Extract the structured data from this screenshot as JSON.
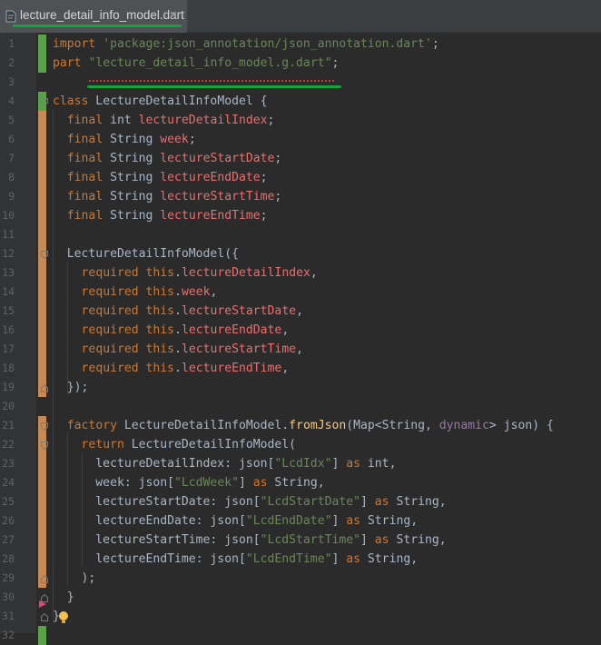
{
  "tab": {
    "filename": "lecture_detail_info_model.dart",
    "close_glyph": "×"
  },
  "lines": [
    {
      "n": "1",
      "change": "green",
      "tokens": [
        [
          "kw",
          "import"
        ],
        [
          "t",
          " "
        ],
        [
          "str",
          "'package:json_annotation/json_annotation.dart'"
        ],
        [
          "t",
          ";"
        ]
      ]
    },
    {
      "n": "2",
      "change": "green",
      "tokens": [
        [
          "kw",
          "part"
        ],
        [
          "t",
          " "
        ],
        [
          "str",
          "\"lecture_detail_info_model.g.dart\""
        ],
        [
          "t",
          ";"
        ]
      ]
    },
    {
      "n": "3",
      "change": "none",
      "tokens": []
    },
    {
      "n": "4",
      "change": "green",
      "tokens": [
        [
          "kw",
          "class"
        ],
        [
          "t",
          " LectureDetailInfoModel {"
        ]
      ]
    },
    {
      "n": "5",
      "change": "orange",
      "tokens": [
        [
          "t",
          "  "
        ],
        [
          "kw",
          "final"
        ],
        [
          "t",
          " int "
        ],
        [
          "fld",
          "lectureDetailIndex"
        ],
        [
          "t",
          ";"
        ]
      ]
    },
    {
      "n": "6",
      "change": "orange",
      "tokens": [
        [
          "t",
          "  "
        ],
        [
          "kw",
          "final"
        ],
        [
          "t",
          " String "
        ],
        [
          "fld",
          "week"
        ],
        [
          "t",
          ";"
        ]
      ]
    },
    {
      "n": "7",
      "change": "orange",
      "tokens": [
        [
          "t",
          "  "
        ],
        [
          "kw",
          "final"
        ],
        [
          "t",
          " String "
        ],
        [
          "fld",
          "lectureStartDate"
        ],
        [
          "t",
          ";"
        ]
      ]
    },
    {
      "n": "8",
      "change": "orange",
      "tokens": [
        [
          "t",
          "  "
        ],
        [
          "kw",
          "final"
        ],
        [
          "t",
          " String "
        ],
        [
          "fld",
          "lectureEndDate"
        ],
        [
          "t",
          ";"
        ]
      ]
    },
    {
      "n": "9",
      "change": "orange",
      "tokens": [
        [
          "t",
          "  "
        ],
        [
          "kw",
          "final"
        ],
        [
          "t",
          " String "
        ],
        [
          "fld",
          "lectureStartTime"
        ],
        [
          "t",
          ";"
        ]
      ]
    },
    {
      "n": "10",
      "change": "orange",
      "tokens": [
        [
          "t",
          "  "
        ],
        [
          "kw",
          "final"
        ],
        [
          "t",
          " String "
        ],
        [
          "fld",
          "lectureEndTime"
        ],
        [
          "t",
          ";"
        ]
      ]
    },
    {
      "n": "11",
      "change": "orange",
      "tokens": []
    },
    {
      "n": "12",
      "change": "orange",
      "tokens": [
        [
          "t",
          "  LectureDetailInfoModel({"
        ]
      ]
    },
    {
      "n": "13",
      "change": "orange",
      "tokens": [
        [
          "t",
          "    "
        ],
        [
          "kw",
          "required"
        ],
        [
          "t",
          " "
        ],
        [
          "kw",
          "this"
        ],
        [
          "t",
          "."
        ],
        [
          "fld",
          "lectureDetailIndex"
        ],
        [
          "t",
          ","
        ]
      ]
    },
    {
      "n": "14",
      "change": "orange",
      "tokens": [
        [
          "t",
          "    "
        ],
        [
          "kw",
          "required"
        ],
        [
          "t",
          " "
        ],
        [
          "kw",
          "this"
        ],
        [
          "t",
          "."
        ],
        [
          "fld",
          "week"
        ],
        [
          "t",
          ","
        ]
      ]
    },
    {
      "n": "15",
      "change": "orange",
      "tokens": [
        [
          "t",
          "    "
        ],
        [
          "kw",
          "required"
        ],
        [
          "t",
          " "
        ],
        [
          "kw",
          "this"
        ],
        [
          "t",
          "."
        ],
        [
          "fld",
          "lectureStartDate"
        ],
        [
          "t",
          ","
        ]
      ]
    },
    {
      "n": "16",
      "change": "orange",
      "tokens": [
        [
          "t",
          "    "
        ],
        [
          "kw",
          "required"
        ],
        [
          "t",
          " "
        ],
        [
          "kw",
          "this"
        ],
        [
          "t",
          "."
        ],
        [
          "fld",
          "lectureEndDate"
        ],
        [
          "t",
          ","
        ]
      ]
    },
    {
      "n": "17",
      "change": "orange",
      "tokens": [
        [
          "t",
          "    "
        ],
        [
          "kw",
          "required"
        ],
        [
          "t",
          " "
        ],
        [
          "kw",
          "this"
        ],
        [
          "t",
          "."
        ],
        [
          "fld",
          "lectureStartTime"
        ],
        [
          "t",
          ","
        ]
      ]
    },
    {
      "n": "18",
      "change": "orange",
      "tokens": [
        [
          "t",
          "    "
        ],
        [
          "kw",
          "required"
        ],
        [
          "t",
          " "
        ],
        [
          "kw",
          "this"
        ],
        [
          "t",
          "."
        ],
        [
          "fld",
          "lectureEndTime"
        ],
        [
          "t",
          ","
        ]
      ]
    },
    {
      "n": "19",
      "change": "orange",
      "tokens": [
        [
          "t",
          "  });"
        ]
      ]
    },
    {
      "n": "20",
      "change": "none",
      "tokens": []
    },
    {
      "n": "21",
      "change": "orange",
      "tokens": [
        [
          "t",
          "  "
        ],
        [
          "kw",
          "factory"
        ],
        [
          "t",
          " LectureDetailInfoModel."
        ],
        [
          "fn",
          "fromJson"
        ],
        [
          "t",
          "(Map<String, "
        ],
        [
          "tp",
          "dynamic"
        ],
        [
          "t",
          "> json) {"
        ]
      ]
    },
    {
      "n": "22",
      "change": "orange",
      "tokens": [
        [
          "t",
          "    "
        ],
        [
          "kw",
          "return"
        ],
        [
          "t",
          " LectureDetailInfoModel("
        ]
      ]
    },
    {
      "n": "23",
      "change": "orange",
      "tokens": [
        [
          "t",
          "      lectureDetailIndex: json["
        ],
        [
          "str",
          "\"LcdIdx\""
        ],
        [
          "t",
          "] "
        ],
        [
          "kw",
          "as"
        ],
        [
          "t",
          " int,"
        ]
      ]
    },
    {
      "n": "24",
      "change": "orange",
      "tokens": [
        [
          "t",
          "      week: json["
        ],
        [
          "str",
          "\"LcdWeek\""
        ],
        [
          "t",
          "] "
        ],
        [
          "kw",
          "as"
        ],
        [
          "t",
          " String,"
        ]
      ]
    },
    {
      "n": "25",
      "change": "orange",
      "tokens": [
        [
          "t",
          "      lectureStartDate: json["
        ],
        [
          "str",
          "\"LcdStartDate\""
        ],
        [
          "t",
          "] "
        ],
        [
          "kw",
          "as"
        ],
        [
          "t",
          " String,"
        ]
      ]
    },
    {
      "n": "26",
      "change": "orange",
      "tokens": [
        [
          "t",
          "      lectureEndDate: json["
        ],
        [
          "str",
          "\"LcdEndDate\""
        ],
        [
          "t",
          "] "
        ],
        [
          "kw",
          "as"
        ],
        [
          "t",
          " String,"
        ]
      ]
    },
    {
      "n": "27",
      "change": "orange",
      "tokens": [
        [
          "t",
          "      lectureStartTime: json["
        ],
        [
          "str",
          "\"LcdStartTime\""
        ],
        [
          "t",
          "] "
        ],
        [
          "kw",
          "as"
        ],
        [
          "t",
          " String,"
        ]
      ]
    },
    {
      "n": "28",
      "change": "orange",
      "tokens": [
        [
          "t",
          "      lectureEndTime: json["
        ],
        [
          "str",
          "\"LcdEndTime\""
        ],
        [
          "t",
          "] "
        ],
        [
          "kw",
          "as"
        ],
        [
          "t",
          " String,"
        ]
      ]
    },
    {
      "n": "29",
      "change": "orange",
      "tokens": [
        [
          "t",
          "    );"
        ]
      ]
    },
    {
      "n": "30",
      "change": "none",
      "tokens": [
        [
          "t",
          "  }"
        ]
      ]
    },
    {
      "n": "31",
      "change": "none",
      "tokens": [
        [
          "t",
          "}"
        ]
      ]
    },
    {
      "n": "32",
      "change": "green",
      "tokens": []
    }
  ],
  "colors": {
    "background": "#2b2b2b",
    "gutter": "#313335",
    "change_added": "#5aa14a",
    "change_modified": "#c68a56",
    "keyword": "#cc7832",
    "string": "#6a8759",
    "field": "#ea6f6f",
    "method": "#ffc66d",
    "default_text": "#a9b7c6",
    "annotation_underline": "#12a53a"
  },
  "icons": {
    "tab_icon": "dart-file-icon",
    "fold": "fold-marker-icon",
    "intention": "lightbulb-icon",
    "breakpoint": "run-arrow-icon"
  }
}
